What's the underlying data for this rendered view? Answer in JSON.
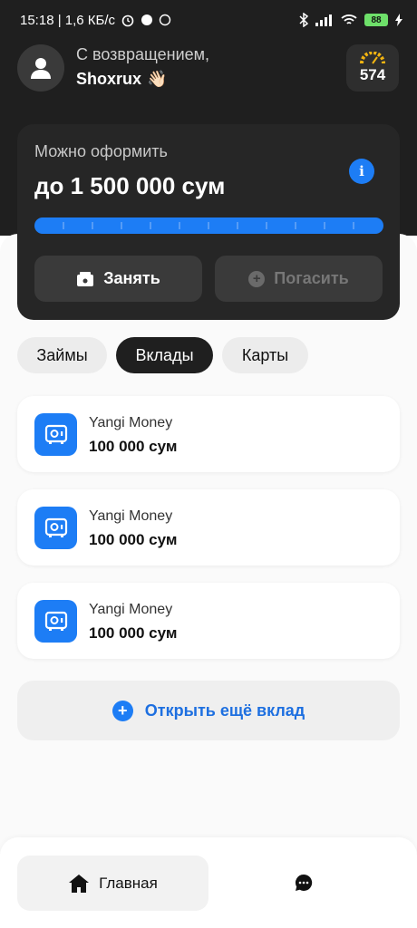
{
  "status_bar": {
    "time_net": "15:18 | 1,6 КБ/с",
    "battery": "88"
  },
  "header": {
    "greeting": "С возвращением,",
    "username": "Shoxrux",
    "emoji": "👋🏻",
    "score": "574"
  },
  "credit": {
    "label": "Можно оформить",
    "amount": "до 1 500 000 сум",
    "info": "i",
    "progress": 1.0,
    "borrow_label": "Занять",
    "repay_label": "Погасить"
  },
  "tabs": [
    {
      "label": "Займы",
      "active": false
    },
    {
      "label": "Вклады",
      "active": true
    },
    {
      "label": "Карты",
      "active": false
    }
  ],
  "deposits": [
    {
      "name": "Yangi Money",
      "amount": "100 000 сум"
    },
    {
      "name": "Yangi Money",
      "amount": "100 000 сум"
    },
    {
      "name": "Yangi Money",
      "amount": "100 000 сум"
    }
  ],
  "open_deposit_label": "Открыть ещё вклад",
  "nav": {
    "home_label": "Главная"
  },
  "colors": {
    "accent": "#1d7df5",
    "dark": "#1f1f1f"
  },
  "icons": [
    "avatar-person-icon",
    "speedometer-icon",
    "info-icon",
    "wallet-icon",
    "plus-icon",
    "safe-icon",
    "home-icon",
    "chat-icon"
  ]
}
